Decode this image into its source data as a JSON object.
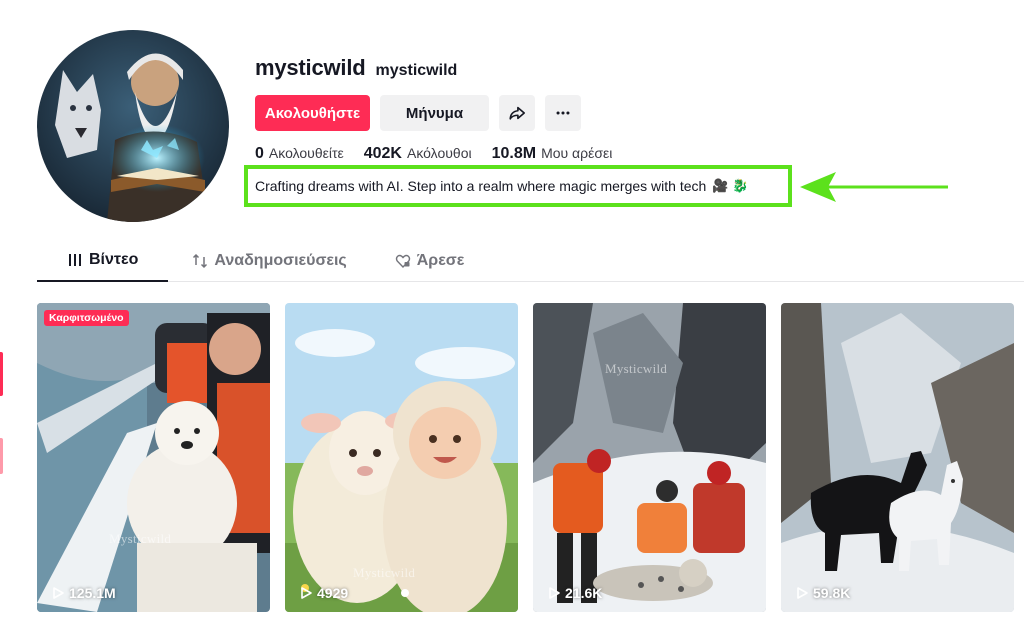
{
  "profile": {
    "unique_id": "mysticwild",
    "nickname": "mysticwild",
    "follow_label": "Ακολουθήστε",
    "message_label": "Μήνυμα",
    "share_icon": "share-icon",
    "more_icon": "more-icon"
  },
  "stats": [
    {
      "value": "0",
      "label": "Ακολουθείτε"
    },
    {
      "value": "402K",
      "label": "Ακόλουθοι"
    },
    {
      "value": "10.8M",
      "label": "Μου αρέσει"
    }
  ],
  "bio": {
    "text": "Crafting dreams with AI. Step into a realm where magic merges with tech",
    "emojis": "🎥 🐉"
  },
  "tabs": [
    {
      "label": "Βίντεο",
      "icon": "grid-icon",
      "active": true
    },
    {
      "label": "Αναδημοσιεύσεις",
      "icon": "repost-icon",
      "active": false
    },
    {
      "label": "Άρεσε",
      "icon": "heart-lock-icon",
      "active": false
    }
  ],
  "videos": [
    {
      "views": "125.1M",
      "pinned_label": "Καρφιτσωμένο",
      "watermark": "Mysticwild"
    },
    {
      "views": "4929",
      "watermark": "Mysticwild"
    },
    {
      "views": "21.6K",
      "watermark": "Mysticwild"
    },
    {
      "views": "59.8K"
    }
  ],
  "colors": {
    "accent": "#fe2c55",
    "highlight": "#5ce11c",
    "text": "#161823",
    "secondary_bg": "#f1f1f2"
  }
}
